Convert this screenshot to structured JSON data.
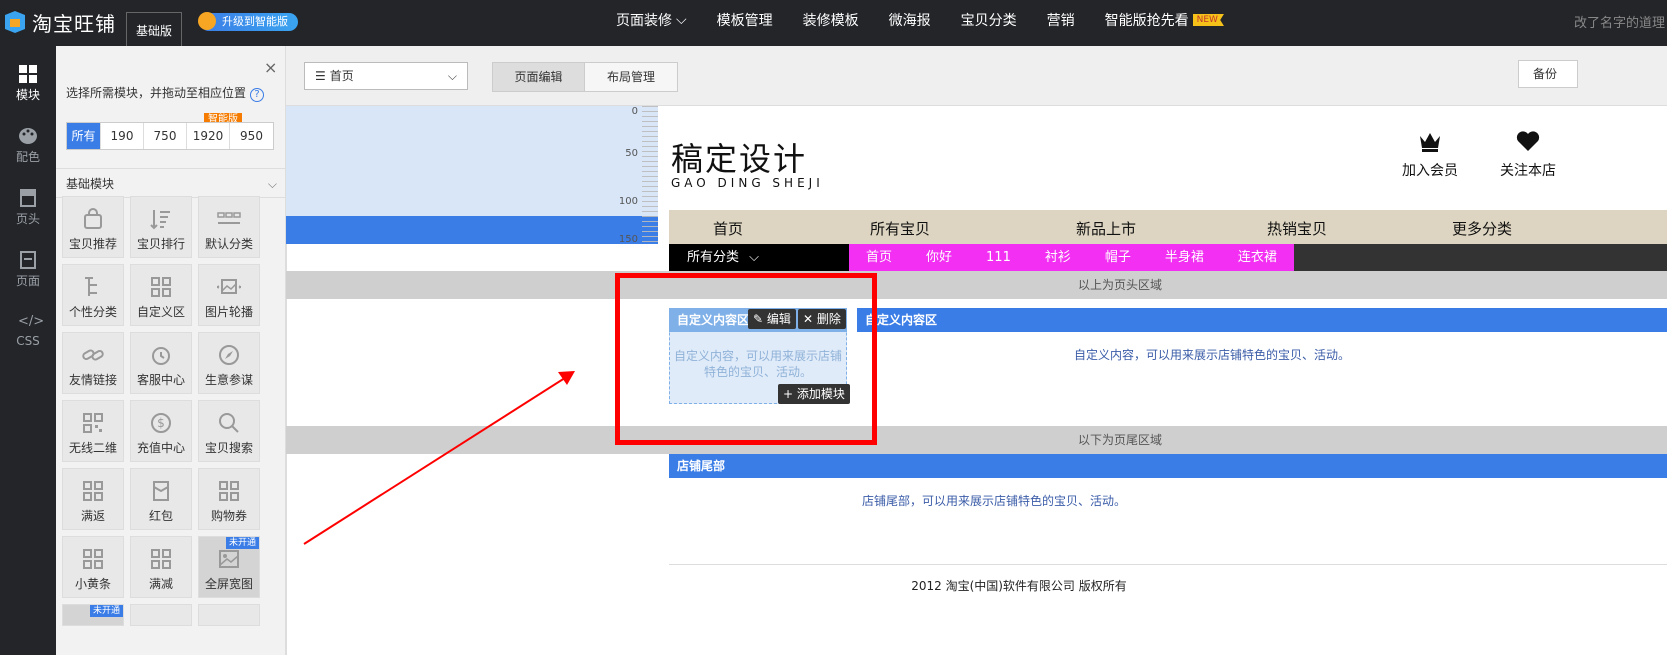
{
  "topbar": {
    "logo_text": "淘宝旺铺",
    "edition": "基础版",
    "upgrade": "升级到智能版",
    "nav": [
      "页面装修",
      "模板管理",
      "装修模板",
      "微海报",
      "宝贝分类",
      "营销",
      "智能版抢先看"
    ],
    "new_badge": "NEW",
    "shop_name": "改了名字的道理"
  },
  "leftbar": {
    "items": [
      "模块",
      "配色",
      "页头",
      "页面",
      "CSS"
    ]
  },
  "panel": {
    "close": "×",
    "hint": "选择所需模块，并拖动至相应位置",
    "help": "?",
    "filters": [
      "所有",
      "190",
      "750",
      "1920",
      "950"
    ],
    "smart_badge": "智能版",
    "section": "基础模块",
    "tiles": [
      "宝贝推荐",
      "宝贝排行",
      "默认分类",
      "个性分类",
      "自定义区",
      "图片轮播",
      "友情链接",
      "客服中心",
      "生意参谋",
      "无线二维",
      "充值中心",
      "宝贝搜索",
      "满返",
      "红包",
      "购物券",
      "小黄条",
      "满减",
      "全屏宽图"
    ],
    "not_open": "未开通"
  },
  "toolbar": {
    "page_select": "首页",
    "tabs": [
      "页面编辑",
      "布局管理"
    ],
    "backup": "备份"
  },
  "ruler": {
    "ticks": [
      "0",
      "50",
      "100",
      "150"
    ]
  },
  "shop_header": {
    "title": "稿定设计",
    "subtitle": "GAO DING SHEJI",
    "join": "加入会员",
    "follow": "关注本店",
    "nav": [
      "首页",
      "所有宝贝",
      "新品上市",
      "热销宝贝",
      "更多分类"
    ],
    "all_category": "所有分类",
    "categories": [
      "首页",
      "你好",
      "111",
      "衬衫",
      "帽子",
      "半身裙",
      "连衣裙"
    ]
  },
  "layout": {
    "above_header": "以上为页头区域",
    "below_footer": "以下为页尾区域",
    "custom_small_title": "自定义内容区",
    "custom_small_desc": "自定义内容，可以用来展示店铺特色的宝贝、活动。",
    "edit": "编辑",
    "delete": "删除",
    "add_module": "添加模块",
    "custom_big_title": "自定义内容区",
    "custom_big_desc": "自定义内容，可以用来展示店铺特色的宝贝、活动。",
    "footer_title": "店铺尾部",
    "footer_desc": "店铺尾部，可以用来展示店铺特色的宝贝、活动。",
    "copyright": "2012 淘宝(中国)软件有限公司 版权所有"
  },
  "colors": {
    "accent": "#3b7de6",
    "annotation": "#ff0000",
    "category_bar": "#f22ff2"
  }
}
